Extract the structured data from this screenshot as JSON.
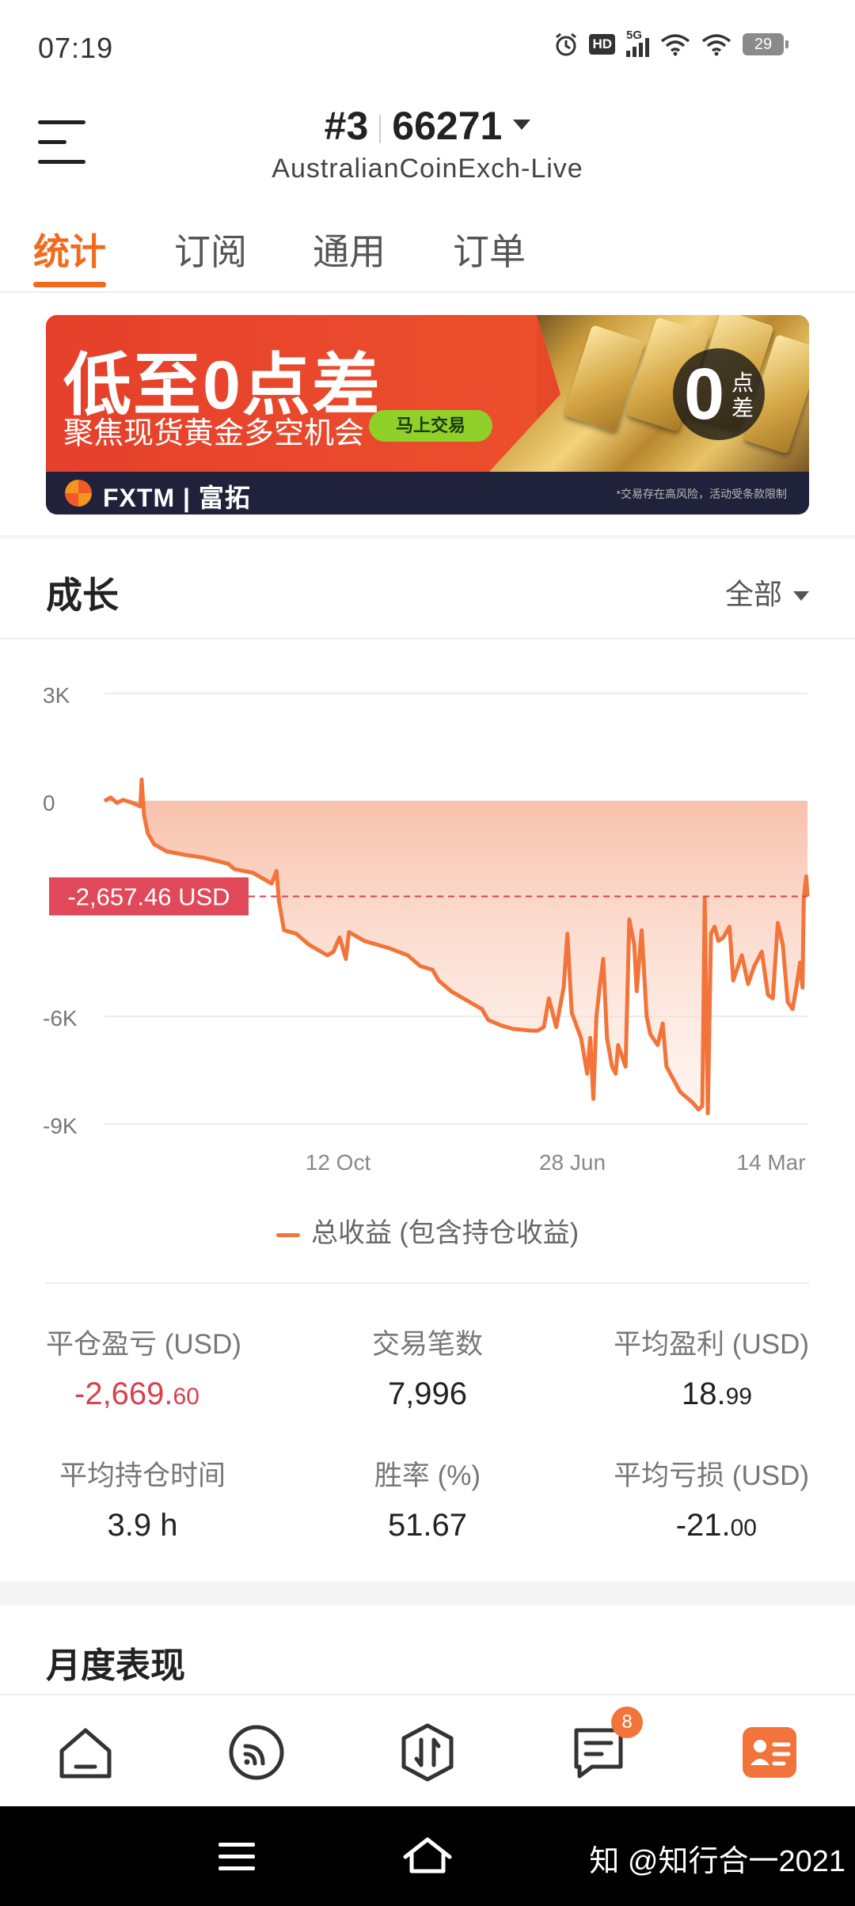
{
  "status_bar": {
    "time": "07:19",
    "network": "5G",
    "hd": "HD",
    "battery": "29"
  },
  "header": {
    "account_rank": "#3",
    "account_number": "66271",
    "server": "AustralianCoinExch-Live"
  },
  "tabs": [
    {
      "label": "统计",
      "active": true
    },
    {
      "label": "订阅",
      "active": false
    },
    {
      "label": "通用",
      "active": false
    },
    {
      "label": "订单",
      "active": false
    }
  ],
  "banner": {
    "title": "低至0点差",
    "subtitle": "聚焦现货黄金多空机会",
    "cta": "马上交易",
    "badge_number": "0",
    "badge_text": "点差",
    "brand": "FXTM | 富拓",
    "disclaimer": "*交易存在高风险，活动受条款限制"
  },
  "growth": {
    "title": "成长",
    "filter": "全部"
  },
  "chart_data": {
    "type": "area",
    "title": "",
    "xlabel": "",
    "ylabel": "",
    "x_tick_labels": [
      "12 Oct",
      "28 Jun",
      "14 Mar"
    ],
    "y_tick_labels": [
      "3K",
      "0",
      "-6K",
      "-9K"
    ],
    "ylim": [
      -9000,
      3000
    ],
    "current_value_label": "-2,657.46 USD",
    "current_value": -2657.46,
    "grid": true,
    "series": [
      {
        "name": "总收益 (包含持仓收益)",
        "color": "#f2743a",
        "points": [
          [
            0.0,
            0
          ],
          [
            0.01,
            100
          ],
          [
            0.02,
            -50
          ],
          [
            0.03,
            30
          ],
          [
            0.045,
            -50
          ],
          [
            0.058,
            -150
          ],
          [
            0.06,
            600
          ],
          [
            0.064,
            -400
          ],
          [
            0.07,
            -900
          ],
          [
            0.08,
            -1200
          ],
          [
            0.1,
            -1400
          ],
          [
            0.13,
            -1500
          ],
          [
            0.16,
            -1580
          ],
          [
            0.2,
            -1750
          ],
          [
            0.21,
            -1900
          ],
          [
            0.24,
            -2000
          ],
          [
            0.27,
            -2300
          ],
          [
            0.278,
            -1950
          ],
          [
            0.282,
            -2800
          ],
          [
            0.29,
            -3600
          ],
          [
            0.31,
            -3700
          ],
          [
            0.33,
            -4000
          ],
          [
            0.36,
            -4300
          ],
          [
            0.37,
            -4200
          ],
          [
            0.38,
            -3800
          ],
          [
            0.39,
            -4400
          ],
          [
            0.395,
            -3650
          ],
          [
            0.42,
            -3900
          ],
          [
            0.46,
            -4100
          ],
          [
            0.49,
            -4300
          ],
          [
            0.51,
            -4600
          ],
          [
            0.53,
            -4700
          ],
          [
            0.54,
            -5000
          ],
          [
            0.56,
            -5300
          ],
          [
            0.59,
            -5600
          ],
          [
            0.61,
            -5800
          ],
          [
            0.62,
            -6100
          ],
          [
            0.64,
            -6250
          ],
          [
            0.66,
            -6350
          ],
          [
            0.69,
            -6400
          ],
          [
            0.7,
            -6400
          ],
          [
            0.71,
            -6300
          ],
          [
            0.718,
            -5500
          ],
          [
            0.73,
            -6300
          ],
          [
            0.742,
            -5200
          ],
          [
            0.748,
            -3700
          ],
          [
            0.755,
            -5900
          ],
          [
            0.77,
            -6600
          ],
          [
            0.78,
            -7600
          ],
          [
            0.785,
            -6600
          ],
          [
            0.79,
            -8300
          ],
          [
            0.795,
            -6000
          ],
          [
            0.8,
            -5200
          ],
          [
            0.806,
            -4400
          ],
          [
            0.812,
            -6600
          ],
          [
            0.82,
            -7400
          ],
          [
            0.826,
            -7600
          ],
          [
            0.83,
            -6800
          ],
          [
            0.842,
            -7400
          ],
          [
            0.848,
            -3300
          ],
          [
            0.856,
            -4000
          ],
          [
            0.86,
            -5300
          ],
          [
            0.868,
            -3600
          ],
          [
            0.876,
            -6000
          ],
          [
            0.882,
            -6500
          ],
          [
            0.894,
            -6800
          ],
          [
            0.902,
            -6200
          ],
          [
            0.908,
            -7400
          ],
          [
            0.93,
            -8100
          ],
          [
            0.95,
            -8400
          ],
          [
            0.96,
            -8600
          ],
          [
            0.966,
            -8500
          ],
          [
            0.97,
            -2700
          ],
          [
            0.975,
            -8700
          ],
          [
            0.98,
            -3700
          ],
          [
            0.986,
            -3500
          ],
          [
            0.992,
            -3900
          ],
          [
            1.0,
            -3800
          ],
          [
            1.01,
            -3500
          ],
          [
            1.016,
            -5000
          ],
          [
            1.03,
            -4300
          ],
          [
            1.04,
            -5100
          ],
          [
            1.05,
            -4600
          ],
          [
            1.062,
            -4200
          ],
          [
            1.072,
            -5400
          ],
          [
            1.08,
            -5500
          ],
          [
            1.088,
            -3400
          ],
          [
            1.096,
            -4000
          ],
          [
            1.104,
            -5600
          ],
          [
            1.112,
            -5800
          ],
          [
            1.118,
            -5200
          ],
          [
            1.124,
            -4500
          ],
          [
            1.128,
            -5200
          ],
          [
            1.13,
            -2700
          ],
          [
            1.134,
            -2100
          ],
          [
            1.136,
            -2657.46
          ]
        ]
      }
    ]
  },
  "stats": {
    "closed_pnl": {
      "label": "平仓盈亏 (USD)",
      "int": "-2,669.",
      "dec": "60"
    },
    "trade_count": {
      "label": "交易笔数",
      "value": "7,996"
    },
    "avg_profit": {
      "label": "平均盈利 (USD)",
      "int": "18.",
      "dec": "99"
    },
    "avg_hold_time": {
      "label": "平均持仓时间",
      "value": "3.9 h"
    },
    "win_rate": {
      "label": "胜率 (%)",
      "value": "51.67"
    },
    "avg_loss": {
      "label": "平均亏损 (USD)",
      "int": "-21.",
      "dec": "00"
    }
  },
  "monthly": {
    "title": "月度表现"
  },
  "bottom_nav": {
    "items": [
      "home-icon",
      "feed-icon",
      "trade-icon",
      "message-icon",
      "profile-icon"
    ],
    "message_badge": "8",
    "active": "profile-icon",
    "accent": "#f2743a"
  },
  "system_nav": {
    "watermark": "知 @知行合一2021"
  }
}
